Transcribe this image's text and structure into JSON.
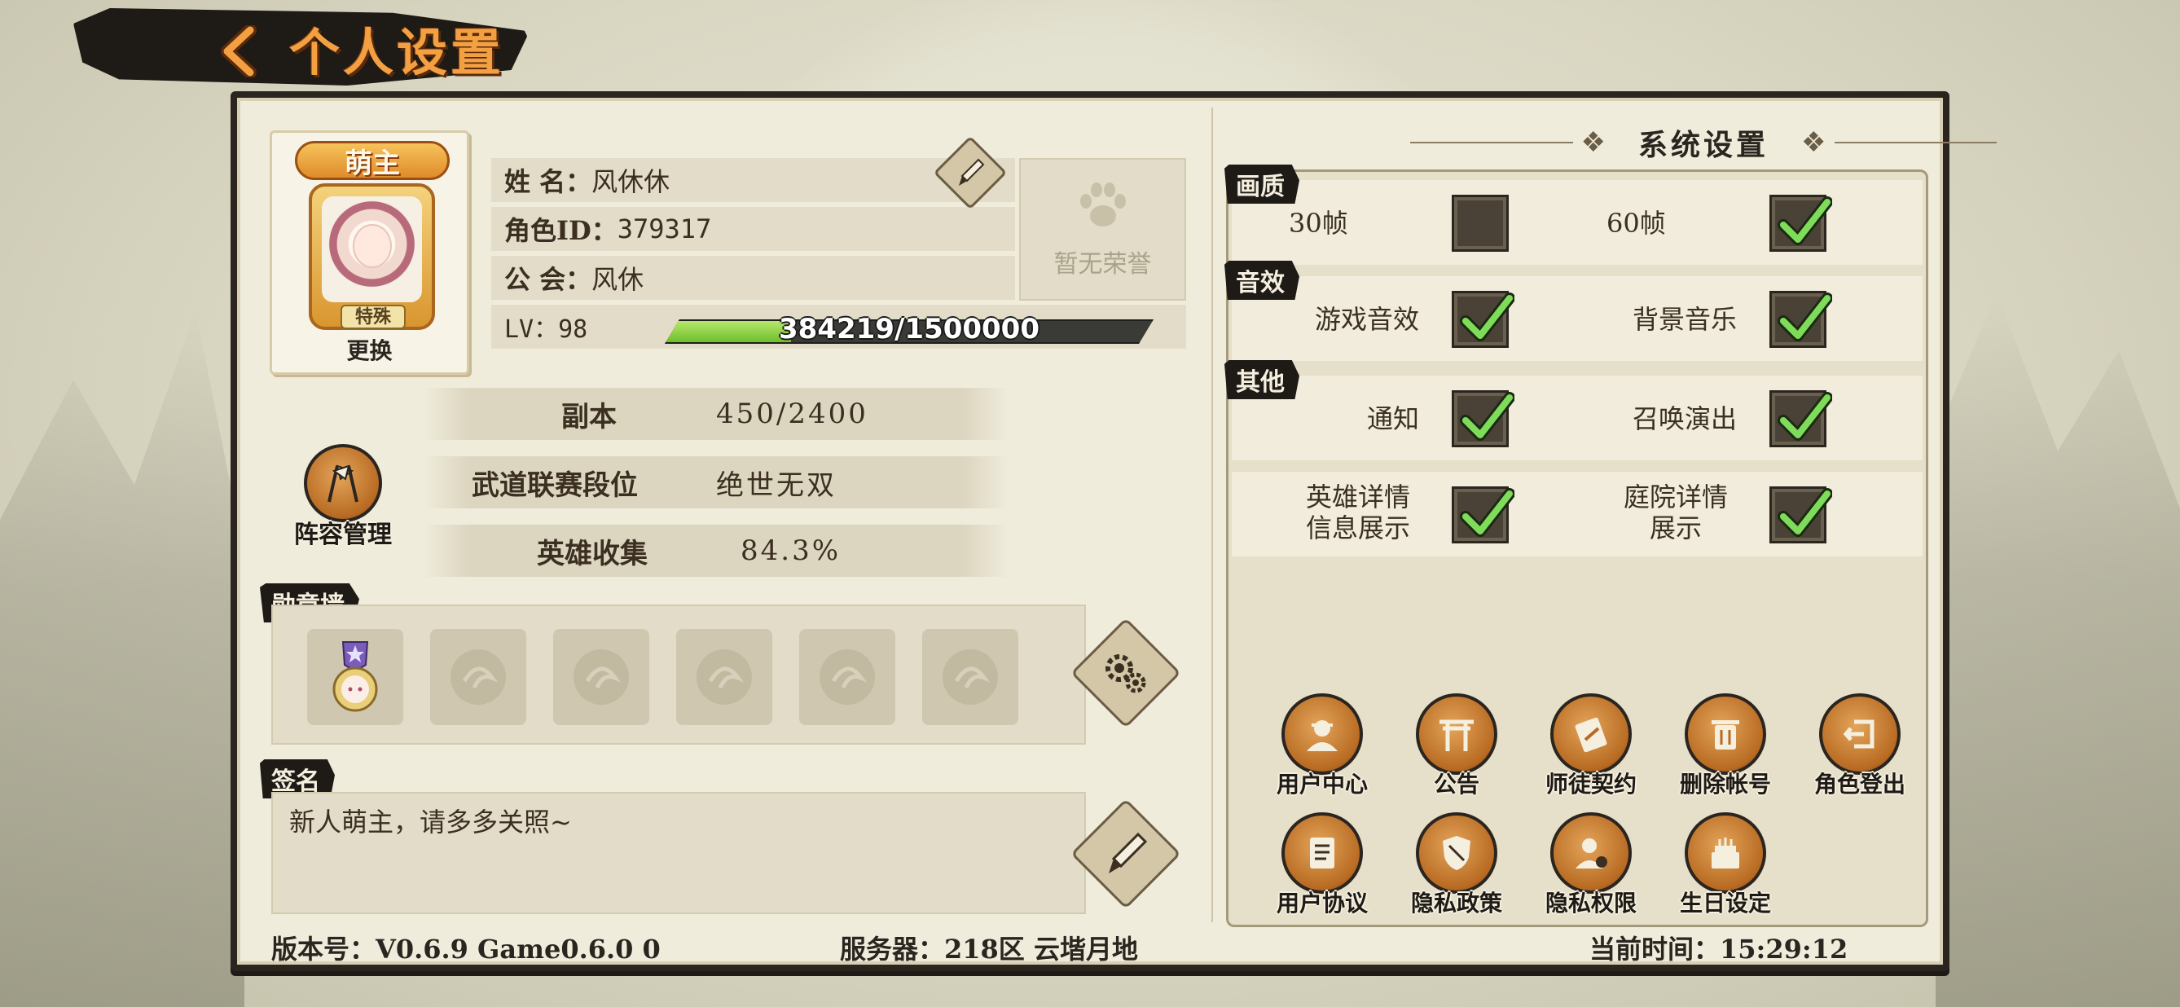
{
  "header": {
    "title": "个人设置"
  },
  "profile": {
    "avatar_banner": "萌主",
    "avatar_tag": "特殊",
    "change_label": "更换",
    "name_label": "姓  名：",
    "name_value": "风休休",
    "id_label": "角色ID：",
    "id_value": "379317",
    "guild_label": "公  会：",
    "guild_value": "风休",
    "honor_text": "暂无荣誉",
    "lv_label": "LV：98",
    "exp_text": "384219/1500000",
    "exp_fraction": 0.256
  },
  "stats": [
    {
      "label": "副本",
      "value": "450/2400"
    },
    {
      "label": "武道联赛段位",
      "value": "绝世无双"
    },
    {
      "label": "英雄收集",
      "value": "84.3%"
    }
  ],
  "team_button": "阵容管理",
  "medal_wall": {
    "title": "勋章墙"
  },
  "signature": {
    "title": "签名",
    "text": "新人萌主，请多多关照~"
  },
  "footer": {
    "version": "版本号：V0.6.9 Game0.6.0 0",
    "server": "服务器：218区 云堦月地",
    "time": "当前时间：15:29:12"
  },
  "system": {
    "title": "系统设置",
    "sections": [
      {
        "tag": "画质",
        "options": [
          {
            "label": "30帧",
            "checked": false
          },
          {
            "label": "60帧",
            "checked": true
          }
        ]
      },
      {
        "tag": "音效",
        "options": [
          {
            "label": "游戏音效",
            "checked": true
          },
          {
            "label": "背景音乐",
            "checked": true
          }
        ]
      },
      {
        "tag": "其他",
        "options": [
          {
            "label": "通知",
            "checked": true
          },
          {
            "label": "召唤演出",
            "checked": true
          }
        ]
      },
      {
        "tag": "",
        "options": [
          {
            "label": "英雄详情\n信息展示",
            "checked": true
          },
          {
            "label": "庭院详情\n展示",
            "checked": true
          }
        ]
      }
    ],
    "buttons_row1": [
      "用户中心",
      "公告",
      "师徒契约",
      "删除帐号",
      "角色登出"
    ],
    "buttons_row2": [
      "用户协议",
      "隐私政策",
      "隐私权限",
      "生日设定"
    ]
  }
}
